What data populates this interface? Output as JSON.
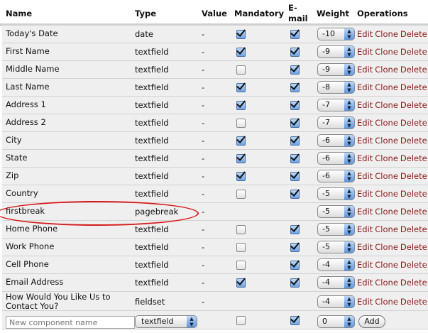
{
  "headers": {
    "name": "Name",
    "type": "Type",
    "value": "Value",
    "mandatory": "Mandatory",
    "email_1": "E-",
    "email_2": "mail",
    "weight": "Weight",
    "operations": "Operations"
  },
  "ops": {
    "edit": "Edit",
    "clone": "Clone",
    "delete": "Delete"
  },
  "rows": [
    {
      "name": "Today's Date",
      "type": "date",
      "value": "-",
      "mandatory": true,
      "email": true,
      "weight": "-10"
    },
    {
      "name": "First Name",
      "type": "textfield",
      "value": "-",
      "mandatory": true,
      "email": true,
      "weight": "-9"
    },
    {
      "name": "Middle Name",
      "type": "textfield",
      "value": "-",
      "mandatory": false,
      "email": true,
      "weight": "-9"
    },
    {
      "name": "Last Name",
      "type": "textfield",
      "value": "-",
      "mandatory": true,
      "email": true,
      "weight": "-8"
    },
    {
      "name": "Address 1",
      "type": "textfield",
      "value": "-",
      "mandatory": true,
      "email": true,
      "weight": "-7"
    },
    {
      "name": "Address 2",
      "type": "textfield",
      "value": "-",
      "mandatory": false,
      "email": true,
      "weight": "-7"
    },
    {
      "name": "City",
      "type": "textfield",
      "value": "-",
      "mandatory": true,
      "email": true,
      "weight": "-6"
    },
    {
      "name": "State",
      "type": "textfield",
      "value": "-",
      "mandatory": true,
      "email": true,
      "weight": "-6"
    },
    {
      "name": "Zip",
      "type": "textfield",
      "value": "-",
      "mandatory": true,
      "email": true,
      "weight": "-6"
    },
    {
      "name": "Country",
      "type": "textfield",
      "value": "-",
      "mandatory": false,
      "email": true,
      "weight": "-5"
    },
    {
      "name": "firstbreak",
      "type": "pagebreak",
      "value": "-",
      "mandatory": null,
      "email": null,
      "weight": "-5"
    },
    {
      "name": "Home Phone",
      "type": "textfield",
      "value": "-",
      "mandatory": false,
      "email": true,
      "weight": "-5"
    },
    {
      "name": "Work Phone",
      "type": "textfield",
      "value": "-",
      "mandatory": false,
      "email": true,
      "weight": "-5"
    },
    {
      "name": "Cell Phone",
      "type": "textfield",
      "value": "-",
      "mandatory": false,
      "email": true,
      "weight": "-4"
    },
    {
      "name": "Email Address",
      "type": "textfield",
      "value": "-",
      "mandatory": true,
      "email": true,
      "weight": "-4"
    },
    {
      "name": "How Would You Like Us to Contact You?",
      "type": "fieldset",
      "value": "-",
      "mandatory": null,
      "email": null,
      "weight": "-4"
    }
  ],
  "new_row": {
    "name_placeholder": "New component name",
    "type": "textfield",
    "mandatory": false,
    "email": true,
    "weight": "0",
    "add_label": "Add"
  },
  "colors": {
    "link": "#8b1a1a",
    "highlight": "#d91818",
    "row_bg": "#efefef"
  }
}
